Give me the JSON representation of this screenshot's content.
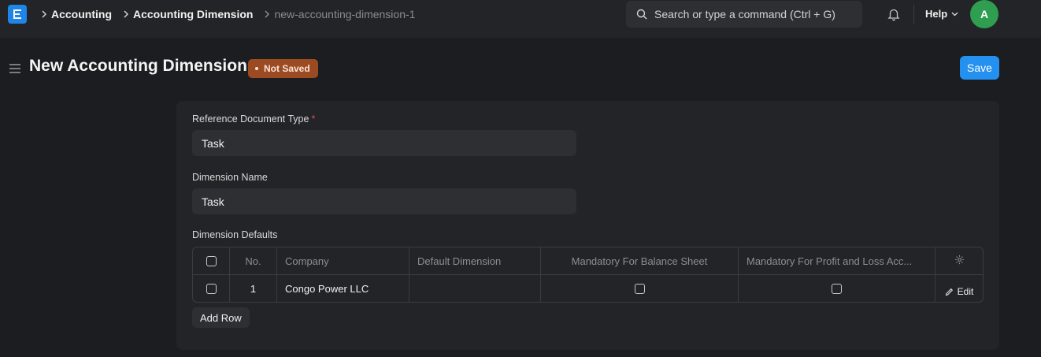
{
  "navbar": {
    "logo_letter": "E",
    "breadcrumbs": [
      {
        "label": "Accounting"
      },
      {
        "label": "Accounting Dimension"
      },
      {
        "label": "new-accounting-dimension-1"
      }
    ],
    "search_placeholder": "Search or type a command (Ctrl + G)",
    "help_label": "Help",
    "avatar_initial": "A"
  },
  "page": {
    "title": "New Accounting Dimension",
    "status_badge": "Not Saved",
    "save_label": "Save"
  },
  "form": {
    "reference_doctype": {
      "label": "Reference Document Type",
      "required": "*",
      "value": "Task"
    },
    "dimension_name": {
      "label": "Dimension Name",
      "value": "Task"
    },
    "defaults": {
      "label": "Dimension Defaults",
      "columns": {
        "no": "No.",
        "company": "Company",
        "default_dimension": "Default Dimension",
        "mandatory_bs": "Mandatory For Balance Sheet",
        "mandatory_pl": "Mandatory For Profit and Loss Acc..."
      },
      "rows": [
        {
          "no": "1",
          "company": "Congo Power LLC",
          "default_dimension": "",
          "mandatory_bs": false,
          "mandatory_pl": false,
          "edit_label": "Edit"
        }
      ],
      "add_row_label": "Add Row"
    }
  },
  "colors": {
    "primary": "#2490ef",
    "badge_bg": "#9b4a22",
    "avatar_bg": "#2f9e50",
    "required": "#e24c4c"
  },
  "icons": [
    "chevron-right-icon",
    "search-icon",
    "bell-icon",
    "chevron-down-icon",
    "hamburger-icon",
    "gear-icon",
    "pencil-icon"
  ]
}
